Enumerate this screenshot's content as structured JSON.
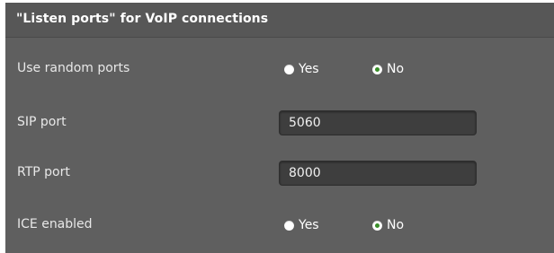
{
  "section": {
    "title": "\"Listen ports\" for VoIP connections"
  },
  "settings": {
    "random_ports": {
      "label": "Use random ports",
      "options": [
        "Yes",
        "No"
      ],
      "selected": "No"
    },
    "sip_port": {
      "label": "SIP port",
      "value": "5060"
    },
    "rtp_port": {
      "label": "RTP port",
      "value": "8000"
    },
    "ice": {
      "label": "ICE enabled",
      "options": [
        "Yes",
        "No"
      ],
      "selected": "No"
    }
  },
  "colors": {
    "panel_bg": "#5f5f5f",
    "header_bg": "#575757",
    "field_bg": "#3e3e3e",
    "radio_selected": "#3a8f2a"
  }
}
